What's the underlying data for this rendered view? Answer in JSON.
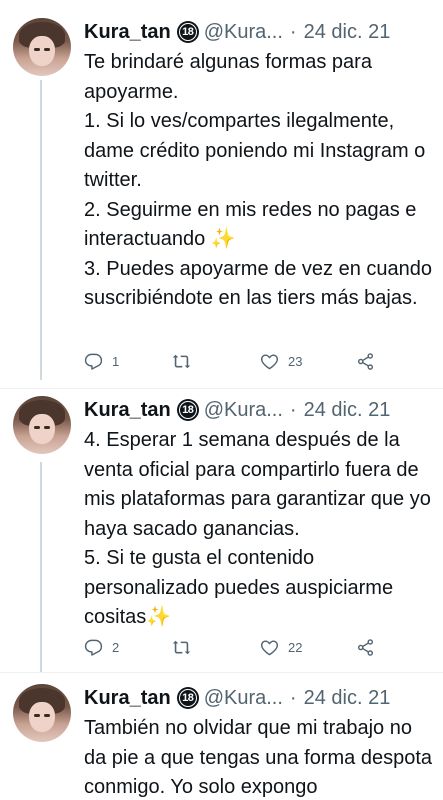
{
  "tweets": [
    {
      "name": "Kura_tan",
      "badge": "18",
      "handle": "@Kura...",
      "separator": "·",
      "date": "24 dic. 21",
      "text": "Te brindaré algunas formas para apoyarme.\n1. Si lo ves/compartes ilegalmente, dame crédito poniendo mi Instagram o twitter.\n2. Seguirme en mis redes no pagas e interactuando ✨\n3. Puedes apoyarme de vez en cuando suscribiéndote en las tiers más bajas.",
      "replies": "1",
      "retweets": "",
      "likes": "23"
    },
    {
      "name": "Kura_tan",
      "badge": "18",
      "handle": "@Kura...",
      "separator": "·",
      "date": "24 dic. 21",
      "text": "4. Esperar 1 semana después de la venta oficial para compartirlo fuera de mis plataformas para garantizar que yo haya sacado ganancias.\n5. Si te gusta el contenido personalizado puedes auspiciarme cositas✨",
      "replies": "2",
      "retweets": "",
      "likes": "22"
    },
    {
      "name": "Kura_tan",
      "badge": "18",
      "handle": "@Kura...",
      "separator": "·",
      "date": "24 dic. 21",
      "text": "También no olvidar que mi trabajo no da pie a que tengas una forma despota conmigo. Yo solo expongo"
    }
  ],
  "colors": {
    "text": "#0f1419",
    "secondary": "#536471",
    "thread_line": "#cfd9de"
  },
  "icons": [
    "reply-icon",
    "retweet-icon",
    "like-icon",
    "share-icon",
    "adult-content-badge-icon"
  ]
}
